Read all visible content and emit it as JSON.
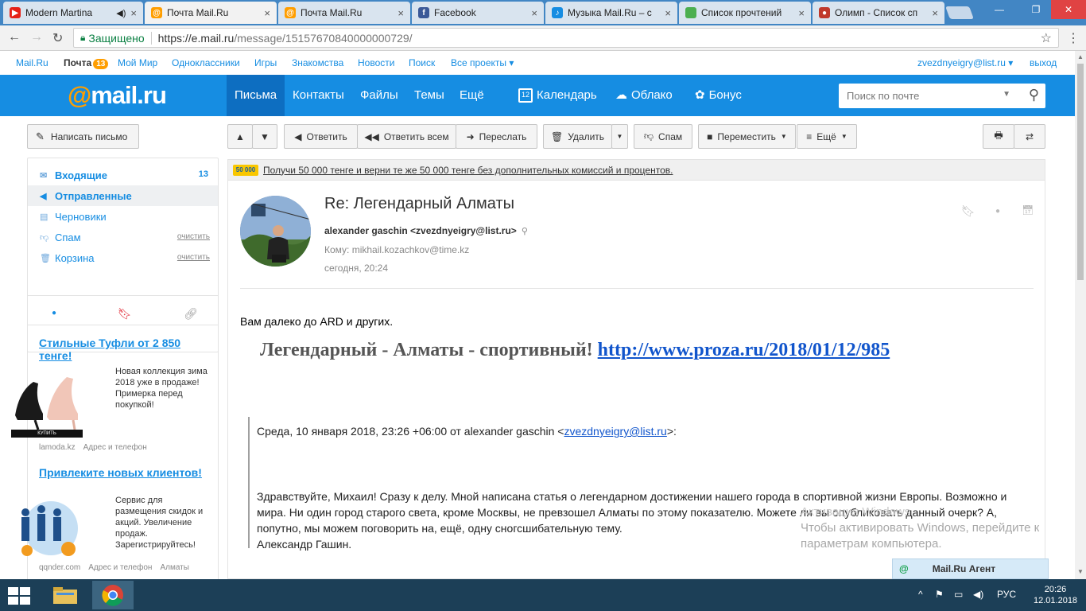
{
  "browser": {
    "tabs": [
      {
        "title": "Modern Martina",
        "favicon_color": "#e62117",
        "icon": "youtube-icon"
      },
      {
        "title": "Почта Mail.Ru",
        "favicon_color": "#168de2",
        "icon": "mailru-icon"
      },
      {
        "title": "Почта Mail.Ru",
        "favicon_color": "#168de2",
        "icon": "mailru-icon"
      },
      {
        "title": "Facebook",
        "favicon_color": "#3b5998",
        "icon": "facebook-icon"
      },
      {
        "title": "Музыка Mail.Ru – с",
        "favicon_color": "#168de2",
        "icon": "music-icon"
      },
      {
        "title": "Список прочтений",
        "favicon_color": "#4caf50",
        "icon": "sheet-icon"
      },
      {
        "title": "Олимп - Список сп",
        "favicon_color": "#c0392b",
        "icon": "olimp-icon"
      }
    ],
    "address": {
      "secure_label": "Защищено",
      "url_host": "https://e.mail.ru",
      "url_path": "/message/15157670840000000729/"
    }
  },
  "topline": {
    "links": [
      "Mail.Ru",
      "Почта",
      "Мой Мир",
      "Одноклассники",
      "Игры",
      "Знакомства",
      "Новости",
      "Поиск",
      "Все проекты ▾"
    ],
    "mail_badge": "13",
    "user": "zvezdnyeigry@list.ru ▾",
    "logout": "выход"
  },
  "header": {
    "logo_at": "@",
    "logo_text": "mail.ru",
    "nav": [
      "Письма",
      "Контакты",
      "Файлы",
      "Темы",
      "Ещё"
    ],
    "calendar": "Календарь",
    "calendar_day": "12",
    "cloud": "Облако",
    "bonus": "Бонус",
    "search_placeholder": "Поиск по почте"
  },
  "sidebar": {
    "compose": "Написать письмо",
    "folders": [
      {
        "label": "Входящие",
        "count": "13"
      },
      {
        "label": "Отправленные"
      },
      {
        "label": "Черновики"
      },
      {
        "label": "Спам",
        "action": "очистить"
      },
      {
        "label": "Корзина",
        "action": "очистить"
      }
    ]
  },
  "ads": [
    {
      "title": "Стильные Туфли от 2 850 тенге!",
      "text": "Новая коллекция зима 2018 уже в продаже! Примерка перед покупкой!",
      "button": "КУПИТЬ",
      "foot": [
        "lamoda.kz",
        "Адрес и телефон"
      ]
    },
    {
      "title": "Привлеките новых клиентов!",
      "text": "Сервис для размещения скидок и акций. Увеличение продаж. Зарегистрируйтесь!",
      "foot": [
        "qqnder.com",
        "Адрес и телефон",
        "Алматы"
      ]
    }
  ],
  "toolbar": {
    "reply": "Ответить",
    "reply_all": "Ответить всем",
    "forward": "Переслать",
    "delete": "Удалить",
    "spam": "Спам",
    "move": "Переместить",
    "more": "Ещё"
  },
  "promo": {
    "icon_text": "50 000",
    "text": "Получи 50 000 тенге и верни те же 50 000 тенге без дополнительных комиссий и процентов."
  },
  "letter": {
    "subject": "Re: Легендарный Алматы",
    "from": "alexander gaschin <zvezdnyeigry@list.ru>",
    "to": "Кому: mikhail.kozachkov@time.kz",
    "date": "сегодня, 20:24",
    "body_line1": "Вам далеко до ARD и других.",
    "headline_text": "Легендарный - Алматы - спортивный! ",
    "headline_link": "http://www.proza.ru/2018/01/12/985",
    "quote_header_pre": "Среда, 10 января 2018, 23:26 +06:00 от alexander gaschin <",
    "quote_header_link": "zvezdnyeigry@list.ru",
    "quote_header_post": ">:",
    "quote_body": "Здравствуйте, Михаил! Сразу к делу. Мной написана статья о легендарном достижении нашего города в спортивной жизни Европы. Возможно и мира. Ни один город старого света, кроме Москвы, не превзошел Алматы по этому показателю. Можете ли вы опубликовать данный очерк? А, попутно, мы можем поговорить на, ещё, одну сногсшибательную тему.",
    "signature": "Александр Гашин."
  },
  "watermark": {
    "line1": "Активация Windows",
    "line2": "Чтобы активировать Windows, перейдите к",
    "line3": "параметрам компьютера."
  },
  "agent": "Mail.Ru Агент",
  "taskbar": {
    "lang": "РУС",
    "time": "20:26",
    "date": "12.01.2018"
  }
}
